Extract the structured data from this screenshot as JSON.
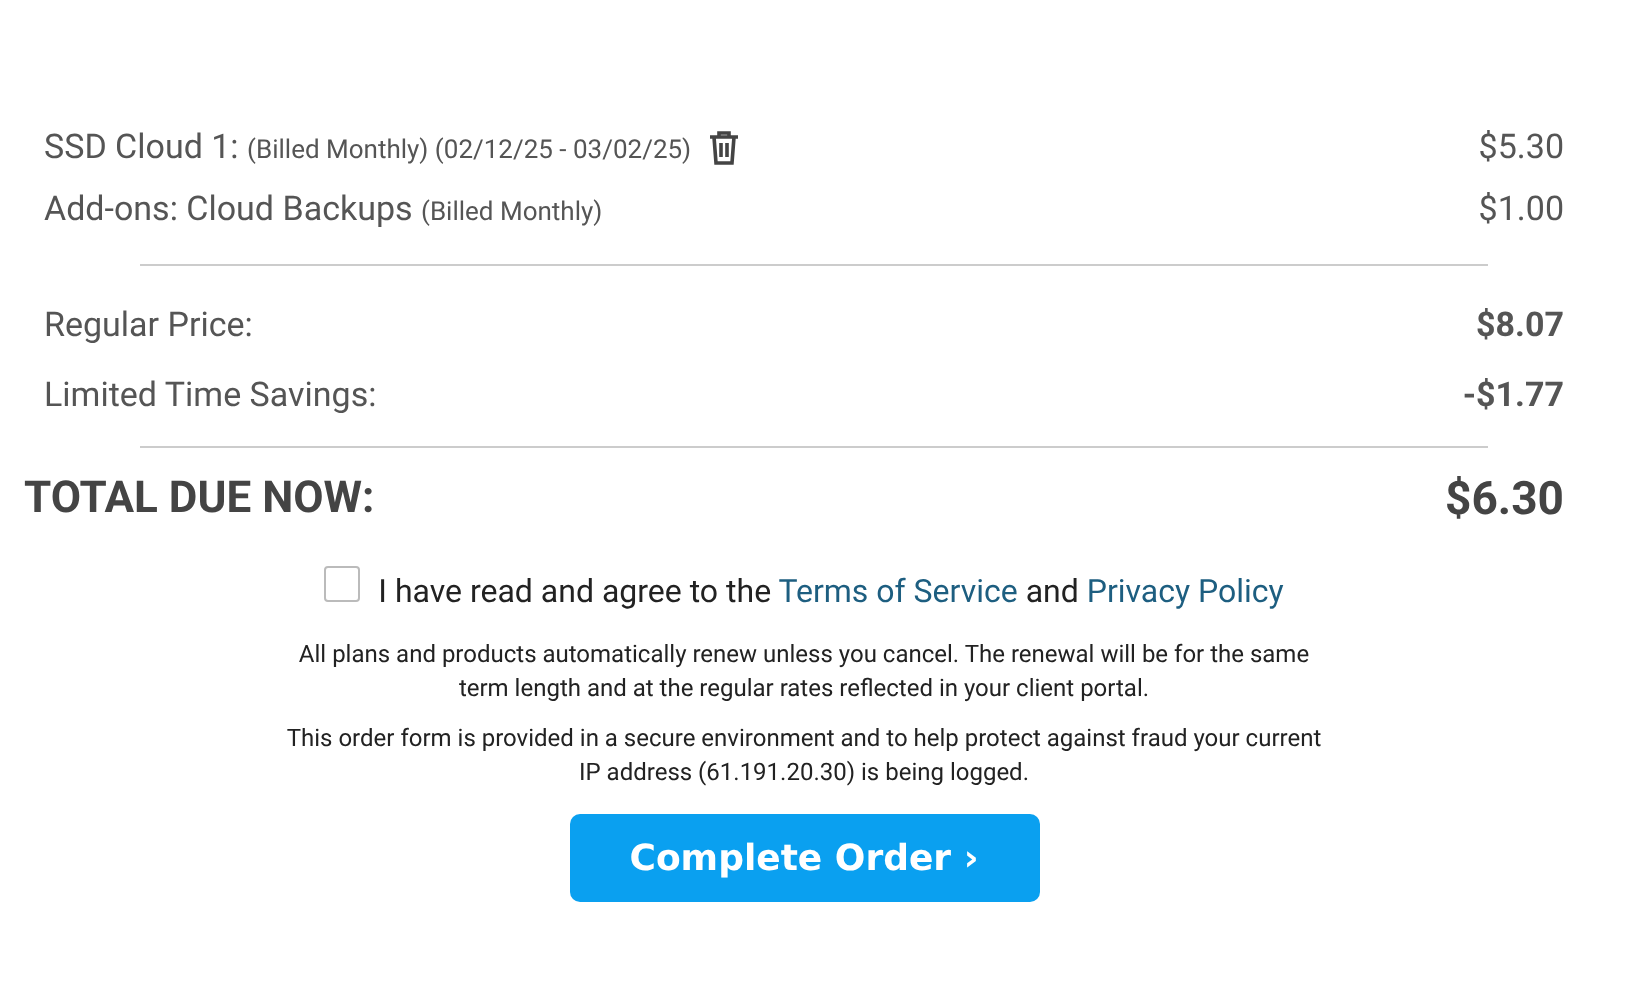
{
  "line_items": [
    {
      "name": "SSD Cloud 1:",
      "details": "(Billed Monthly) (02/12/25 - 03/02/25)",
      "price": "$5.30",
      "removable": true
    },
    {
      "name": "Add-ons: Cloud Backups",
      "details": "(Billed Monthly)",
      "price": "$1.00",
      "removable": false
    }
  ],
  "summary": [
    {
      "label": "Regular Price:",
      "value": "$8.07"
    },
    {
      "label": "Limited Time Savings:",
      "value": "-$1.77"
    }
  ],
  "total": {
    "label": "TOTAL DUE NOW:",
    "value": "$6.30"
  },
  "agreement": {
    "checked": false,
    "text_before": "I have read and agree to the",
    "terms_link": "Terms of Service",
    "text_between": "and",
    "privacy_link": "Privacy Policy"
  },
  "notes": [
    "All plans and products automatically renew unless you cancel. The renewal will be for the same term length and at the regular rates reflected in your client portal.",
    "This order form is provided in a secure environment and to help protect against fraud your current IP address (61.191.20.30) is being logged."
  ],
  "button": {
    "label": "Complete Order ›"
  }
}
